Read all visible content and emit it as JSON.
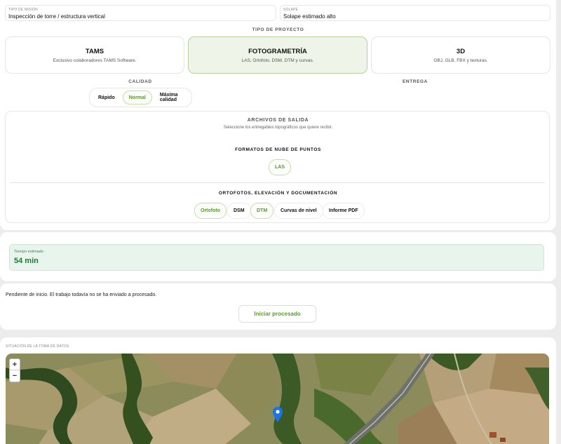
{
  "mission": {
    "label": "TIPO DE MISIÓN",
    "value": "Inspección de torre / estructura vertical"
  },
  "overlap": {
    "label": "SOLAPE",
    "value": "Solape estimado alto"
  },
  "project_type": {
    "title": "TIPO DE PROYECTO",
    "options": [
      {
        "title": "TAMS",
        "subtitle": "Exclusivo colaboradores TAMS Software."
      },
      {
        "title": "FOTOGRAMETRÍA",
        "subtitle": "LAS, Ortofoto, DSM, DTM y curvas."
      },
      {
        "title": "3D",
        "subtitle": "OBJ, GLB, FBX y texturas."
      }
    ],
    "selected": "FOTOGRAMETRÍA"
  },
  "quality": {
    "title": "CALIDAD",
    "options": [
      "Rápido",
      "Normal",
      "Máxima calidad"
    ],
    "selected": "Normal"
  },
  "delivery": {
    "title": "ENTREGA"
  },
  "outputs": {
    "title": "ARCHIVOS DE SALIDA",
    "subtitle": "Seleccione los entregables topográficos que quiere recibir.",
    "point_cloud": {
      "title": "FORMATOS DE NUBE DE PUNTOS",
      "items": [
        "LAS"
      ],
      "selected": [
        "LAS"
      ]
    },
    "ortho": {
      "title": "ORTOFOTOS, ELEVACIÓN Y DOCUMENTACIÓN",
      "items": [
        "Ortofoto",
        "DSM",
        "DTM",
        "Curvas de nivel",
        "Informe PDF"
      ],
      "selected": [
        "Ortofoto",
        "DTM"
      ]
    }
  },
  "estimate": {
    "label": "Tiempo estimado",
    "value": "54 min"
  },
  "status": {
    "text": "Pendiente de inicio. El trabajo todavía no se ha enviado a procesado.",
    "button": "Iniciar procesado"
  },
  "map": {
    "label": "SITUACIÓN DE LA TOMA DE DATOS",
    "zoom_in": "+",
    "zoom_out": "−",
    "marker_icon": "map-pin-icon"
  },
  "colors": {
    "accent": "#5a9a2a",
    "selected_bg": "#eff4e8",
    "estimate_bg": "#e8f5ec",
    "estimate_text": "#1e7a36",
    "pin": "#1a73e8"
  }
}
